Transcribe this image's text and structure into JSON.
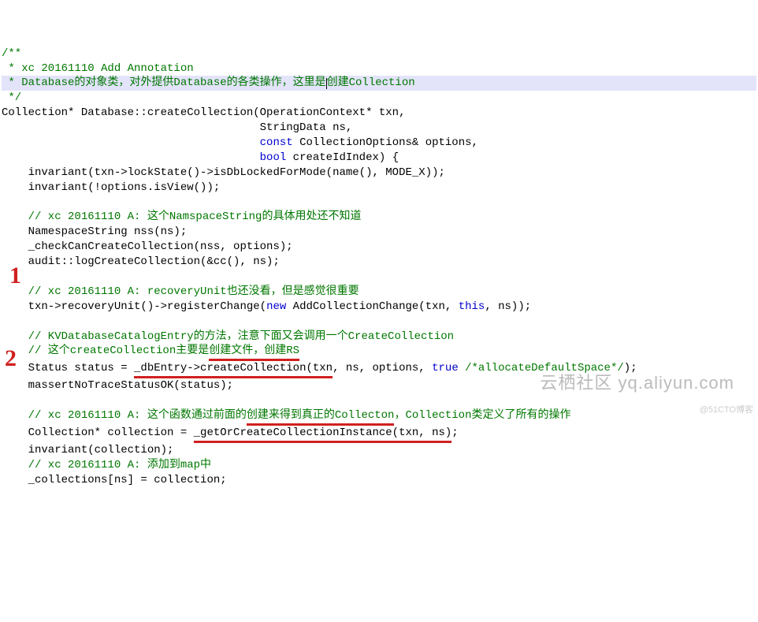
{
  "code": {
    "c1": "/**",
    "c2": " * xc 20161110 Add Annotation",
    "c3_a": " * Database的对象类，对外提供Database的各类操作，这里是",
    "c3_b": "创建Collection",
    "c4": " */",
    "sig_a": "Collection* Database::createCollection(OperationContext* txn,",
    "sig_b": "                                       StringData ns,",
    "sig_c_pre": "                                       ",
    "sig_c_kw": "const",
    "sig_c_post": " CollectionOptions& options,",
    "sig_d_pre": "                                       ",
    "sig_d_kw": "bool",
    "sig_d_post": " createIdIndex) {",
    "l1": "    invariant(txn->lockState()->isDbLockedForMode(name(), MODE_X));",
    "l2": "    invariant(!options.isView());",
    "blank": "",
    "c5": "    // xc 20161110 A: 这个NamspaceString的具体用处还不知道",
    "l3": "    NamespaceString nss(ns);",
    "l4": "    _checkCanCreateCollection(nss, options);",
    "l5": "    audit::logCreateCollection(&cc(), ns);",
    "c6": "    // xc 20161110 A: recoveryUnit也还没看，但是感觉很重要",
    "l6_a": "    txn->recoveryUnit()->registerChange(",
    "l6_new": "new",
    "l6_b": " AddCollectionChange(txn, ",
    "l6_this": "this",
    "l6_c": ", ns));",
    "c7": "    // KVDatabaseCatalogEntry的方法，注意下面又会调用一个CreateCollection",
    "c8": "    // 这个createCollection主要是",
    "c8_u": "创建文件，创建RS",
    "l7_a": "    Status status = ",
    "l7_u": "_dbEntry->createCollection(txn",
    "l7_b": ", ns, options, ",
    "l7_true": "true",
    "l7_cmt": " /*allocateDefaultSpace*/",
    "l7_c": ");",
    "l8": "    massertNoTraceStatusOK(status);",
    "c9_a": "    // xc 20161110 A: 这个函数通过前面的",
    "c9_u": "创建来得到真正的Collecton",
    "c9_b": "，Collection类定义了所有的操作",
    "l9_a": "    Collection* collection = ",
    "l9_u": "_getOrCreateCollectionInstance(txn, ns)",
    "l9_b": ";",
    "l10": "    invariant(collection);",
    "c10": "    // xc 20161110 A: 添加到map中",
    "l11": "    _collections[ns] = collection;"
  },
  "annotations": {
    "marker1": "1",
    "marker2": "2"
  },
  "watermark": {
    "main": "云栖社区 yq.aliyun.com",
    "corner": "@51CTO博客"
  }
}
